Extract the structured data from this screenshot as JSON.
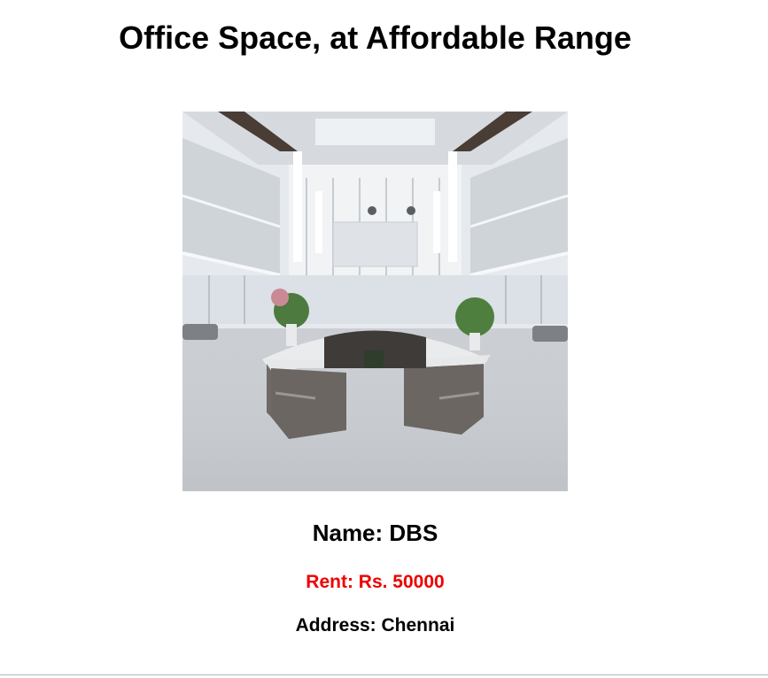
{
  "page": {
    "title": "Office Space, at Affordable Range"
  },
  "listing": {
    "image_alt": "Office lobby with circular reception desk",
    "name": "Name: DBS",
    "rent": "Rent: Rs. 50000",
    "address": "Address: Chennai"
  },
  "colors": {
    "rent_text": "#ee0000",
    "text": "#000000",
    "background": "#ffffff"
  }
}
